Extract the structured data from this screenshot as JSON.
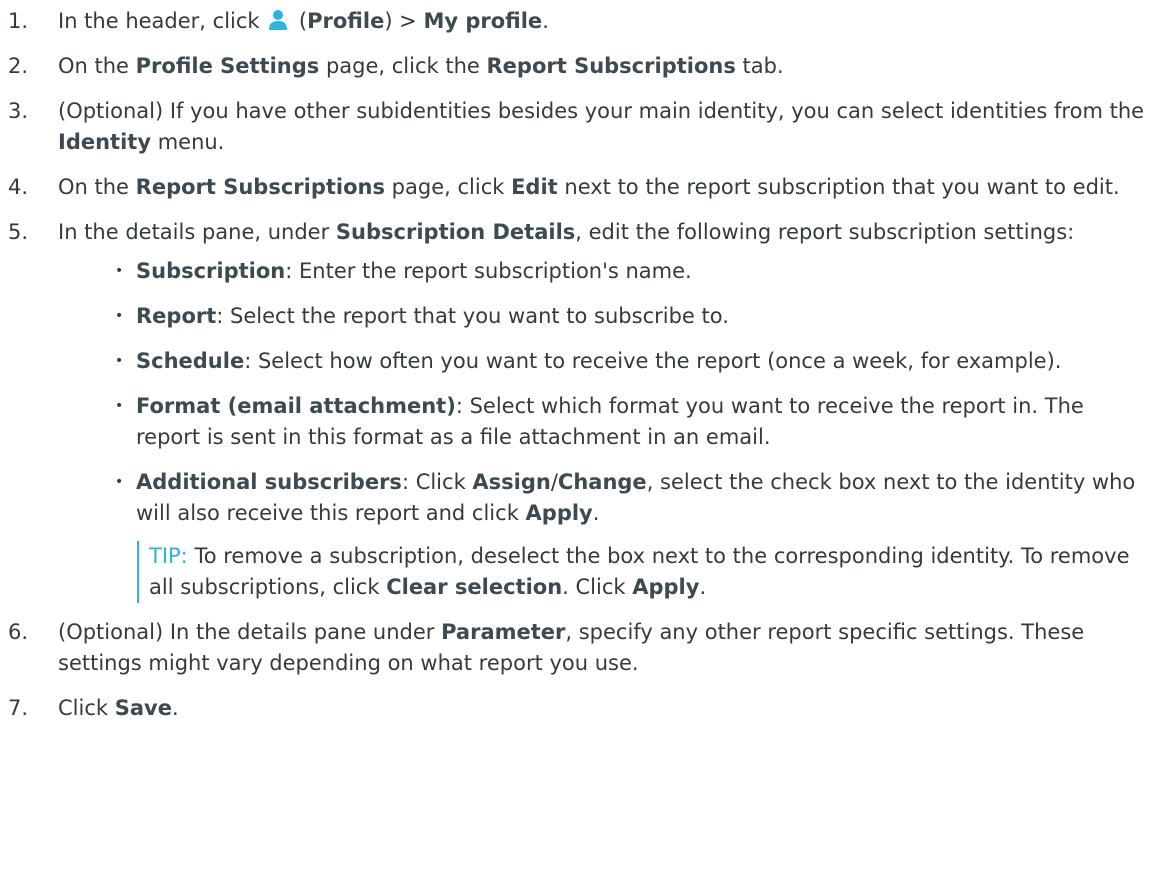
{
  "steps": [
    {
      "num": "1.",
      "parts": [
        {
          "t": "In the header, click "
        },
        {
          "icon": "profile-icon"
        },
        {
          "t": " ("
        },
        {
          "b": "Profile"
        },
        {
          "t": ") > "
        },
        {
          "b": "My profile"
        },
        {
          "t": "."
        }
      ]
    },
    {
      "num": "2.",
      "parts": [
        {
          "t": "On the "
        },
        {
          "b": "Profile Settings"
        },
        {
          "t": " page, click the "
        },
        {
          "b": "Report Subscriptions"
        },
        {
          "t": " tab."
        }
      ]
    },
    {
      "num": "3.",
      "parts": [
        {
          "t": "(Optional) If you have other subidentities besides your main identity, you can select identities from the "
        },
        {
          "b": "Identity"
        },
        {
          "t": " menu."
        }
      ]
    },
    {
      "num": "4.",
      "parts": [
        {
          "t": "On the "
        },
        {
          "b": "Report Subscriptions"
        },
        {
          "t": " page, click "
        },
        {
          "b": "Edit"
        },
        {
          "t": " next to the report subscription that you want to edit."
        }
      ]
    },
    {
      "num": "5.",
      "parts": [
        {
          "t": "In the details pane, under "
        },
        {
          "b": "Subscription Details"
        },
        {
          "t": ", edit the following report subscription settings:"
        }
      ],
      "bullets": [
        [
          {
            "b": "Subscription"
          },
          {
            "t": ": Enter the report subscription's name."
          }
        ],
        [
          {
            "b": "Report"
          },
          {
            "t": ": Select the report that you want to subscribe to."
          }
        ],
        [
          {
            "b": "Schedule"
          },
          {
            "t": ": Select how often you want to receive the report (once a week, for example)."
          }
        ],
        [
          {
            "b": "Format (email attachment)"
          },
          {
            "t": ": Select which format you want to receive the report in. The report is sent in this format as a file attachment in an email."
          }
        ],
        [
          {
            "b": "Additional subscribers"
          },
          {
            "t": ": Click "
          },
          {
            "b": "Assign"
          },
          {
            "t": "/"
          },
          {
            "b": "Change"
          },
          {
            "t": ", select the check box next to the identity who will also receive this report and click "
          },
          {
            "b": "Apply"
          },
          {
            "t": "."
          }
        ]
      ],
      "tip": [
        {
          "tip": "TIP:"
        },
        {
          "t": " To remove a subscription, deselect the box next to the corresponding identity. To remove all subscriptions, click "
        },
        {
          "b": "Clear selection"
        },
        {
          "t": ". Click "
        },
        {
          "b": "Apply"
        },
        {
          "t": "."
        }
      ]
    },
    {
      "num": "6.",
      "parts": [
        {
          "t": "(Optional) In the details pane under "
        },
        {
          "b": "Parameter"
        },
        {
          "t": ", specify any other report specific settings. These settings might vary depending on what report you use."
        }
      ]
    },
    {
      "num": "7.",
      "parts": [
        {
          "t": "Click "
        },
        {
          "b": "Save"
        },
        {
          "t": "."
        }
      ]
    }
  ],
  "colors": {
    "text": "#333a40",
    "accent": "#2eb4dc"
  }
}
